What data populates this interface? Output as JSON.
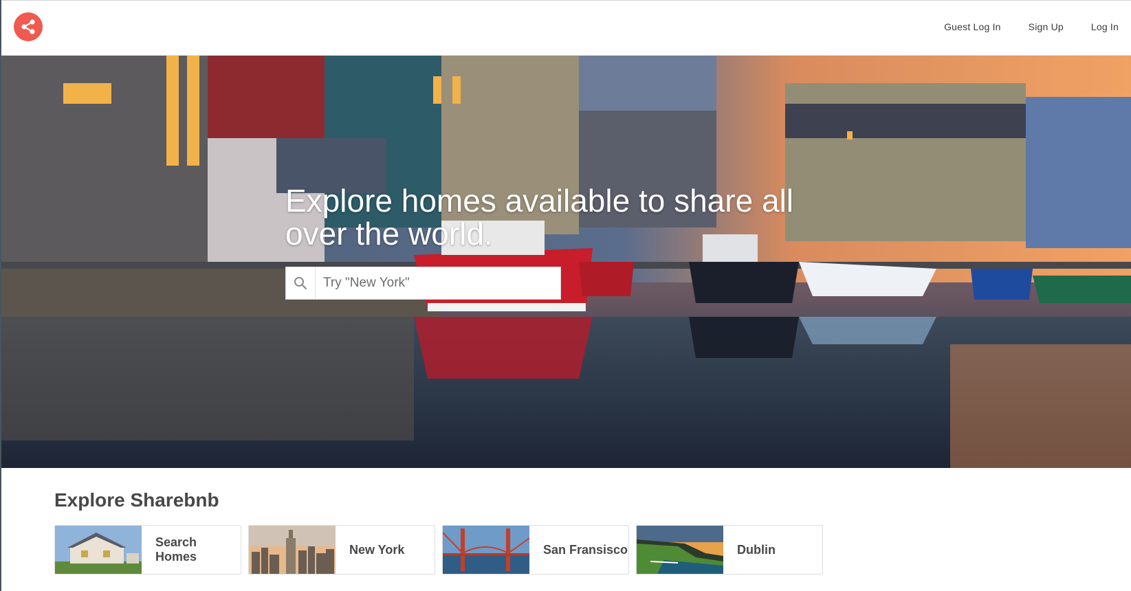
{
  "header": {
    "logo_icon": "share-icon",
    "brand_color": "#f05a4f",
    "nav": [
      {
        "label": "Guest Log In"
      },
      {
        "label": "Sign Up"
      },
      {
        "label": "Log In"
      }
    ]
  },
  "hero": {
    "title": "Explore homes available to share all over the world.",
    "search": {
      "placeholder": "Try \"New York\"",
      "value": "",
      "icon": "search-icon"
    }
  },
  "explore": {
    "title": "Explore Sharebnb",
    "cards": [
      {
        "label": "Search Homes",
        "image": "suburban-house"
      },
      {
        "label": "New York",
        "image": "city-skyline"
      },
      {
        "label": "San Fransisco",
        "image": "golden-gate-bridge"
      },
      {
        "label": "Dublin",
        "image": "coastal-cliffs"
      }
    ]
  }
}
